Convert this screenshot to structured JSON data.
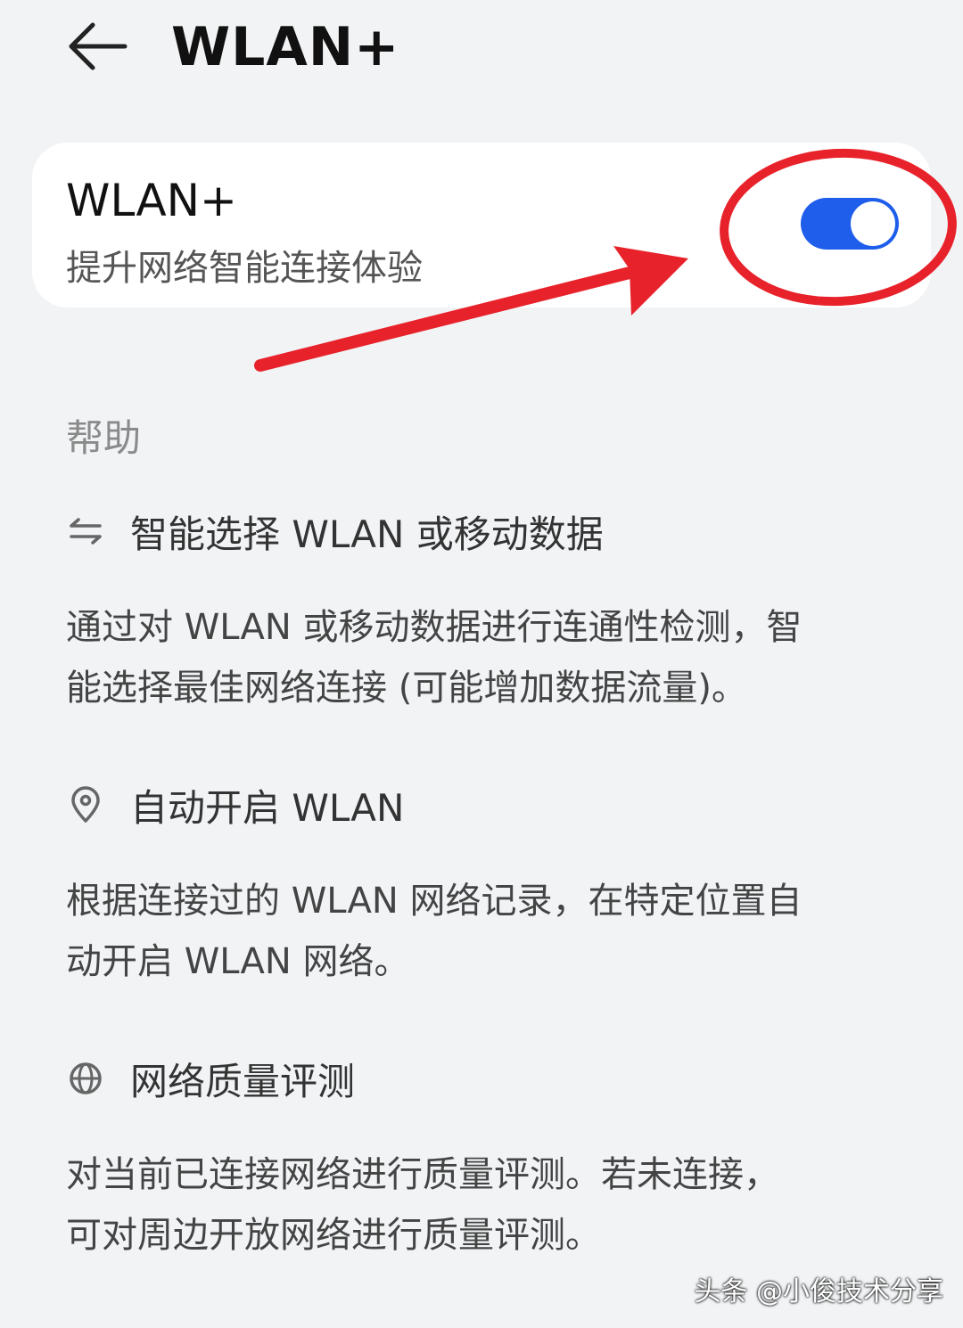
{
  "header": {
    "title": "WLAN+"
  },
  "card": {
    "title": "WLAN+",
    "subtitle": "提升网络智能连接体验",
    "toggle_on": true
  },
  "help": {
    "label": "帮助",
    "items": [
      {
        "icon": "swap-arrows-icon",
        "title": "智能选择 WLAN 或移动数据",
        "desc_line1": "通过对 WLAN 或移动数据进行连通性检测，智",
        "desc_line2": "能选择最佳网络连接 (可能增加数据流量)。"
      },
      {
        "icon": "location-pin-icon",
        "title": "自动开启 WLAN",
        "desc_line1": "根据连接过的 WLAN 网络记录，在特定位置自",
        "desc_line2": "动开启 WLAN 网络。"
      },
      {
        "icon": "globe-icon",
        "title": "网络质量评测",
        "desc_line1": "对当前已连接网络进行质量评测。若未连接，",
        "desc_line2": "可对周边开放网络进行质量评测。"
      }
    ]
  },
  "watermark": "头条 @小俊技术分享",
  "colors": {
    "background": "#f1f3f5",
    "toggle_on": "#1e5eea",
    "annotation_red": "#e8222b"
  }
}
